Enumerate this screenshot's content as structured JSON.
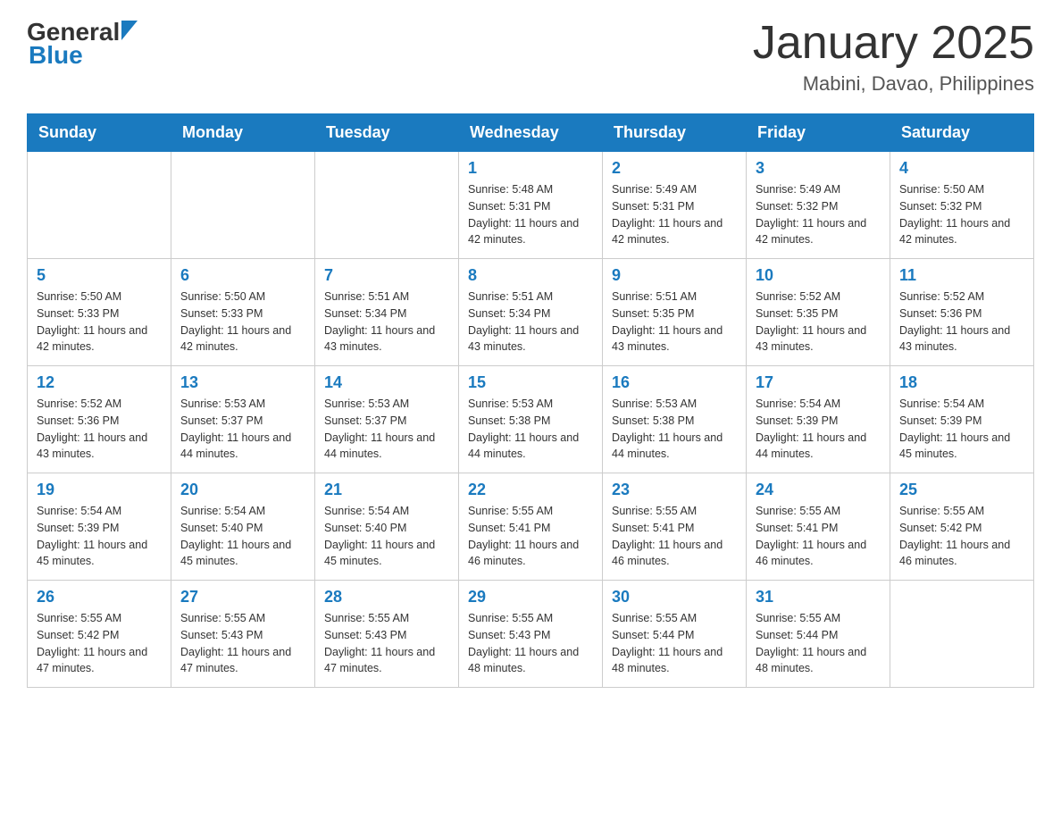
{
  "logo": {
    "general": "General",
    "blue": "Blue"
  },
  "title": {
    "month_year": "January 2025",
    "location": "Mabini, Davao, Philippines"
  },
  "headers": [
    "Sunday",
    "Monday",
    "Tuesday",
    "Wednesday",
    "Thursday",
    "Friday",
    "Saturday"
  ],
  "weeks": [
    [
      {
        "day": "",
        "info": ""
      },
      {
        "day": "",
        "info": ""
      },
      {
        "day": "",
        "info": ""
      },
      {
        "day": "1",
        "info": "Sunrise: 5:48 AM\nSunset: 5:31 PM\nDaylight: 11 hours and 42 minutes."
      },
      {
        "day": "2",
        "info": "Sunrise: 5:49 AM\nSunset: 5:31 PM\nDaylight: 11 hours and 42 minutes."
      },
      {
        "day": "3",
        "info": "Sunrise: 5:49 AM\nSunset: 5:32 PM\nDaylight: 11 hours and 42 minutes."
      },
      {
        "day": "4",
        "info": "Sunrise: 5:50 AM\nSunset: 5:32 PM\nDaylight: 11 hours and 42 minutes."
      }
    ],
    [
      {
        "day": "5",
        "info": "Sunrise: 5:50 AM\nSunset: 5:33 PM\nDaylight: 11 hours and 42 minutes."
      },
      {
        "day": "6",
        "info": "Sunrise: 5:50 AM\nSunset: 5:33 PM\nDaylight: 11 hours and 42 minutes."
      },
      {
        "day": "7",
        "info": "Sunrise: 5:51 AM\nSunset: 5:34 PM\nDaylight: 11 hours and 43 minutes."
      },
      {
        "day": "8",
        "info": "Sunrise: 5:51 AM\nSunset: 5:34 PM\nDaylight: 11 hours and 43 minutes."
      },
      {
        "day": "9",
        "info": "Sunrise: 5:51 AM\nSunset: 5:35 PM\nDaylight: 11 hours and 43 minutes."
      },
      {
        "day": "10",
        "info": "Sunrise: 5:52 AM\nSunset: 5:35 PM\nDaylight: 11 hours and 43 minutes."
      },
      {
        "day": "11",
        "info": "Sunrise: 5:52 AM\nSunset: 5:36 PM\nDaylight: 11 hours and 43 minutes."
      }
    ],
    [
      {
        "day": "12",
        "info": "Sunrise: 5:52 AM\nSunset: 5:36 PM\nDaylight: 11 hours and 43 minutes."
      },
      {
        "day": "13",
        "info": "Sunrise: 5:53 AM\nSunset: 5:37 PM\nDaylight: 11 hours and 44 minutes."
      },
      {
        "day": "14",
        "info": "Sunrise: 5:53 AM\nSunset: 5:37 PM\nDaylight: 11 hours and 44 minutes."
      },
      {
        "day": "15",
        "info": "Sunrise: 5:53 AM\nSunset: 5:38 PM\nDaylight: 11 hours and 44 minutes."
      },
      {
        "day": "16",
        "info": "Sunrise: 5:53 AM\nSunset: 5:38 PM\nDaylight: 11 hours and 44 minutes."
      },
      {
        "day": "17",
        "info": "Sunrise: 5:54 AM\nSunset: 5:39 PM\nDaylight: 11 hours and 44 minutes."
      },
      {
        "day": "18",
        "info": "Sunrise: 5:54 AM\nSunset: 5:39 PM\nDaylight: 11 hours and 45 minutes."
      }
    ],
    [
      {
        "day": "19",
        "info": "Sunrise: 5:54 AM\nSunset: 5:39 PM\nDaylight: 11 hours and 45 minutes."
      },
      {
        "day": "20",
        "info": "Sunrise: 5:54 AM\nSunset: 5:40 PM\nDaylight: 11 hours and 45 minutes."
      },
      {
        "day": "21",
        "info": "Sunrise: 5:54 AM\nSunset: 5:40 PM\nDaylight: 11 hours and 45 minutes."
      },
      {
        "day": "22",
        "info": "Sunrise: 5:55 AM\nSunset: 5:41 PM\nDaylight: 11 hours and 46 minutes."
      },
      {
        "day": "23",
        "info": "Sunrise: 5:55 AM\nSunset: 5:41 PM\nDaylight: 11 hours and 46 minutes."
      },
      {
        "day": "24",
        "info": "Sunrise: 5:55 AM\nSunset: 5:41 PM\nDaylight: 11 hours and 46 minutes."
      },
      {
        "day": "25",
        "info": "Sunrise: 5:55 AM\nSunset: 5:42 PM\nDaylight: 11 hours and 46 minutes."
      }
    ],
    [
      {
        "day": "26",
        "info": "Sunrise: 5:55 AM\nSunset: 5:42 PM\nDaylight: 11 hours and 47 minutes."
      },
      {
        "day": "27",
        "info": "Sunrise: 5:55 AM\nSunset: 5:43 PM\nDaylight: 11 hours and 47 minutes."
      },
      {
        "day": "28",
        "info": "Sunrise: 5:55 AM\nSunset: 5:43 PM\nDaylight: 11 hours and 47 minutes."
      },
      {
        "day": "29",
        "info": "Sunrise: 5:55 AM\nSunset: 5:43 PM\nDaylight: 11 hours and 48 minutes."
      },
      {
        "day": "30",
        "info": "Sunrise: 5:55 AM\nSunset: 5:44 PM\nDaylight: 11 hours and 48 minutes."
      },
      {
        "day": "31",
        "info": "Sunrise: 5:55 AM\nSunset: 5:44 PM\nDaylight: 11 hours and 48 minutes."
      },
      {
        "day": "",
        "info": ""
      }
    ]
  ]
}
